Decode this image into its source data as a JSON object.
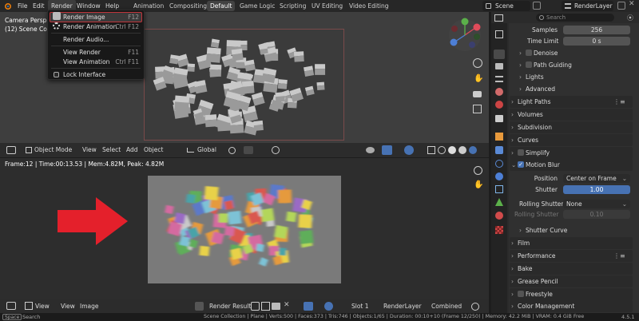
{
  "topbar": {
    "menus": [
      "File",
      "Edit",
      "Render",
      "Window",
      "Help"
    ],
    "workspaces": [
      "Animation",
      "Compositing",
      "Default",
      "Game Logic",
      "Scripting",
      "UV Editing",
      "Video Editing"
    ],
    "scene": "Scene",
    "view_layer": "RenderLayer"
  },
  "render_menu": {
    "items": [
      {
        "label": "Render Image",
        "shortcut": "F12",
        "highlighted": true
      },
      {
        "label": "Render Animation",
        "shortcut": "Ctrl F12"
      },
      {
        "label": "Render Audio...",
        "shortcut": ""
      },
      {
        "label": "View Render",
        "shortcut": "F11"
      },
      {
        "label": "View Animation",
        "shortcut": "Ctrl F11"
      },
      {
        "label": "Lock Interface",
        "shortcut": ""
      }
    ]
  },
  "viewport": {
    "title_line1": "Camera Perspe",
    "title_line2": "(12) Scene Coll",
    "header": {
      "mode": "Object Mode",
      "view": "View",
      "select": "Select",
      "add": "Add",
      "object": "Object",
      "pivot": "Global"
    }
  },
  "image_editor": {
    "info": "Frame:12 | Time:00:13.53 | Mem:4.82M, Peak: 4.82M",
    "header": {
      "view": "View",
      "view2": "View",
      "image": "Image",
      "image_name": "Render Result",
      "slot": "Slot 1",
      "layer": "RenderLayer",
      "pass": "Combined"
    }
  },
  "properties": {
    "search_placeholder": "Search",
    "samples_label": "Samples",
    "samples_value": "256",
    "time_limit_label": "Time Limit",
    "time_limit_value": "0 s",
    "denoise": "Denoise",
    "path_guiding": "Path Guiding",
    "lights": "Lights",
    "advanced": "Advanced",
    "light_paths": "Light Paths",
    "volumes": "Volumes",
    "subdivision": "Subdivision",
    "curves": "Curves",
    "simplify": "Simplify",
    "motion_blur": "Motion Blur",
    "position_label": "Position",
    "position_value": "Center on Frame",
    "shutter_label": "Shutter",
    "shutter_value": "1.00",
    "rolling_label": "Rolling Shutter",
    "rolling_value": "None",
    "rolling_dur_label": "Rolling Shutter ...",
    "rolling_dur_value": "0.10",
    "shutter_curve": "Shutter Curve",
    "film": "Film",
    "performance": "Performance",
    "bake": "Bake",
    "grease_pencil": "Grease Pencil",
    "freestyle": "Freestyle",
    "color_management": "Color Management"
  },
  "status": {
    "key": "Space",
    "search": "Search",
    "stats": "Scene Collection | Plane | Verts:500 | Faces:373 | Tris:746 | Objects:1/65 | Duration: 00:10+10 (Frame 12/250) | Memory: 42.2 MiB | VRAM: 0.4 GiB Free",
    "version": "4.5.1"
  },
  "colors": {
    "accent": "#4772b3",
    "highlight_border": "#c0343b",
    "arrow": "#e4202b"
  }
}
